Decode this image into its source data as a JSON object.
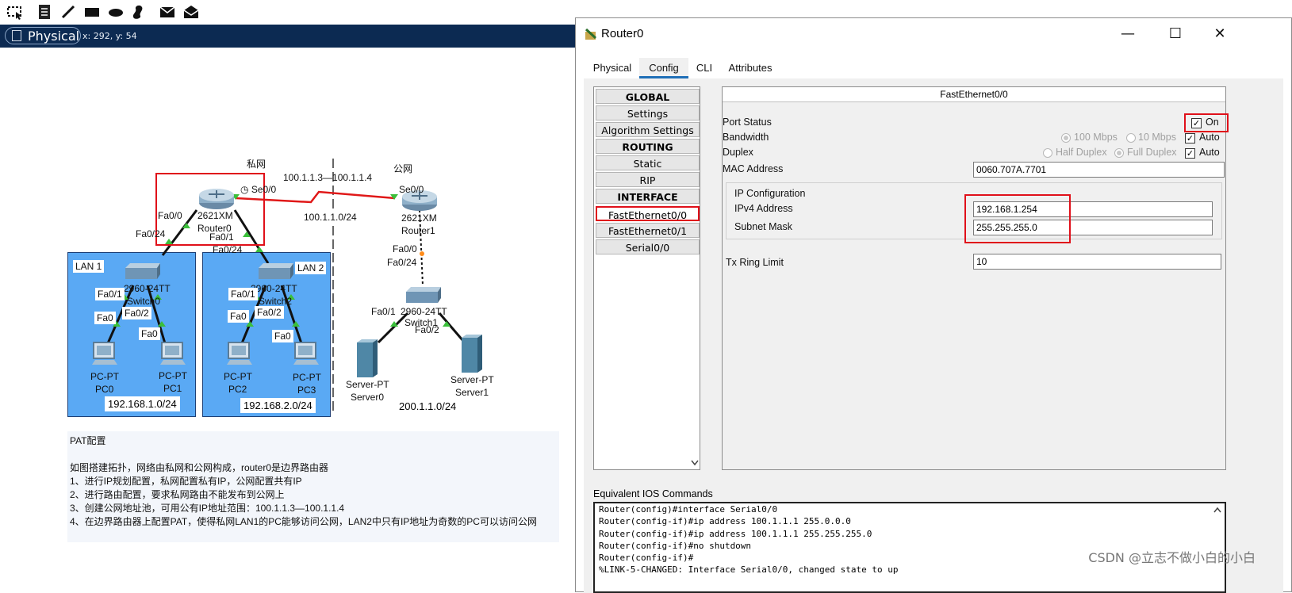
{
  "toolbar": {
    "icons": [
      "select-region-icon",
      "note-icon",
      "line-icon",
      "rectangle-icon",
      "ellipse-icon",
      "freeform-icon",
      "simple-pdu-icon",
      "complex-pdu-icon"
    ]
  },
  "modebar": {
    "physical_label": "Physical",
    "coords": "x: 292, y: 54"
  },
  "topology": {
    "private_label": "私网",
    "public_label": "公网",
    "public_range": "100.1.1.3—100.1.1.4",
    "serial_net": "100.1.1.0/24",
    "router0": {
      "port_se": "Se0/0",
      "model": "2621XM",
      "name": "Router0",
      "fa0": "Fa0/0",
      "fa1": "Fa0/1",
      "fa0_net": "Fa0/24",
      "fa1_net": "Fa0/24"
    },
    "router1": {
      "port_se": "Se0/0",
      "model": "2621XM",
      "name": "Router1",
      "fa0": "Fa0/0",
      "fa0_sw": "Fa0/24"
    },
    "lan1": {
      "label": "LAN 1",
      "switch": "2960-24TT",
      "switch_name": "Switch0",
      "p1": "Fa0/1",
      "p2": "Fa0/2",
      "pc_a": "Fa0",
      "pc_b": "Fa0",
      "pc0_type": "PC-PT",
      "pc0_name": "PC0",
      "pc1_type": "PC-PT",
      "pc1_name": "PC1",
      "net": "192.168.1.0/24"
    },
    "lan2": {
      "label": "LAN 2",
      "switch": "2960-24TT",
      "switch_name": "Switch2",
      "p1": "Fa0/1",
      "p2": "Fa0/2",
      "pc_a": "Fa0",
      "pc_b": "Fa0",
      "pc2_type": "PC-PT",
      "pc2_name": "PC2",
      "pc3_type": "PC-PT",
      "pc3_name": "PC3",
      "net": "192.168.2.0/24"
    },
    "public_lan": {
      "switch": "2960-24TT",
      "switch_name": "Switch1",
      "p1": "Fa0/1",
      "p2": "Fa0/2",
      "srv0_type": "Server-PT",
      "srv0_name": "Server0",
      "srv1_type": "Server-PT",
      "srv1_name": "Server1",
      "net": "200.1.1.0/24"
    }
  },
  "notes": {
    "title": "PAT配置",
    "lines": [
      "如图搭建拓扑，网络由私网和公网构成，router0是边界路由器",
      "1、进行IP规划配置，私网配置私有IP，公网配置共有IP",
      "2、进行路由配置，要求私网路由不能发布到公网上",
      "3、创建公网地址池，可用公有IP地址范围：100.1.1.3—100.1.1.4",
      "4、在边界路由器上配置PAT，使得私网LAN1的PC能够访问公网，LAN2中只有IP地址为奇数的PC可以访问公网"
    ]
  },
  "dialog": {
    "title": "Router0",
    "tabs": [
      "Physical",
      "Config",
      "CLI",
      "Attributes"
    ],
    "active_tab": "Config",
    "nav": [
      {
        "label": "GLOBAL",
        "header": true
      },
      {
        "label": "Settings",
        "header": false
      },
      {
        "label": "Algorithm Settings",
        "header": false
      },
      {
        "label": "ROUTING",
        "header": true
      },
      {
        "label": "Static",
        "header": false
      },
      {
        "label": "RIP",
        "header": false
      },
      {
        "label": "INTERFACE",
        "header": true
      },
      {
        "label": "FastEthernet0/0",
        "header": false
      },
      {
        "label": "FastEthernet0/1",
        "header": false
      },
      {
        "label": "Serial0/0",
        "header": false
      }
    ],
    "panel": {
      "header": "FastEthernet0/0",
      "port_status_label": "Port Status",
      "port_status_value": "On",
      "bandwidth_label": "Bandwidth",
      "bw_100": "100 Mbps",
      "bw_10": "10 Mbps",
      "auto1": "Auto",
      "duplex_label": "Duplex",
      "half": "Half Duplex",
      "full": "Full Duplex",
      "auto2": "Auto",
      "mac_label": "MAC Address",
      "mac_value": "0060.707A.7701",
      "ipconf_title": "IP Configuration",
      "ipv4_label": "IPv4 Address",
      "ipv4_value": "192.168.1.254",
      "mask_label": "Subnet Mask",
      "mask_value": "255.255.255.0",
      "tx_label": "Tx Ring Limit",
      "tx_value": "10"
    },
    "eq_label": "Equivalent IOS Commands",
    "console": [
      "Router(config)#interface Serial0/0",
      "Router(config-if)#ip address 100.1.1.1 255.0.0.0",
      "Router(config-if)#ip address 100.1.1.1 255.255.255.0",
      "Router(config-if)#no shutdown",
      "Router(config-if)#",
      "%LINK-5-CHANGED: Interface Serial0/0, changed state to up"
    ]
  },
  "watermark": "CSDN @立志不做小白的小白"
}
